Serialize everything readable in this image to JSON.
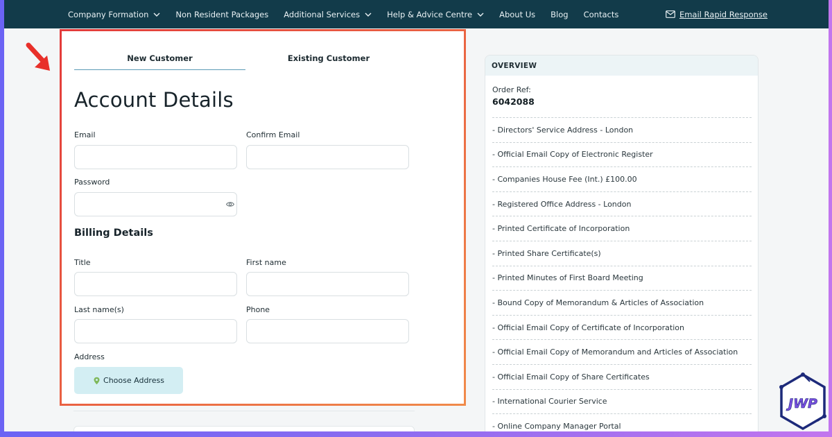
{
  "nav": {
    "items": [
      {
        "label": "Company Formation",
        "dropdown": true
      },
      {
        "label": "Non Resident Packages",
        "dropdown": false
      },
      {
        "label": "Additional Services",
        "dropdown": true
      },
      {
        "label": "Help & Advice Centre",
        "dropdown": true
      },
      {
        "label": "About Us",
        "dropdown": false
      },
      {
        "label": "Blog",
        "dropdown": false
      },
      {
        "label": "Contacts",
        "dropdown": false
      }
    ],
    "rapid_label": "Email Rapid Response"
  },
  "tabs": {
    "new_customer": "New Customer",
    "existing_customer": "Existing Customer"
  },
  "form": {
    "title": "Account Details",
    "email_label": "Email",
    "confirm_email_label": "Confirm Email",
    "password_label": "Password",
    "billing_title": "Billing Details",
    "title_label": "Title",
    "first_name_label": "First name",
    "last_name_label": "Last name(s)",
    "phone_label": "Phone",
    "address_label": "Address",
    "choose_address": "Choose Address"
  },
  "overview": {
    "header": "OVERVIEW",
    "order_ref_label": "Order Ref:",
    "order_ref": "6042088",
    "items": [
      "- Directors' Service Address - London",
      "- Official Email Copy of Electronic Register",
      "- Companies House Fee (Int.) £100.00",
      "- Registered Office Address - London",
      "- Printed Certificate of Incorporation",
      "- Printed Share Certificate(s)",
      "- Printed Minutes of First Board Meeting",
      "- Bound Copy of Memorandum & Articles of Association",
      "- Official Email Copy of Certificate of Incorporation",
      "- Official Email Copy of Memorandum and Articles of Association",
      "- Official Email Copy of Share Certificates",
      "- International Courier Service",
      "- Online Company Manager Portal"
    ]
  },
  "logo": {
    "text": "JWP"
  },
  "colors": {
    "nav_bg": "#123b4a",
    "highlight_border": "#e85a3a",
    "address_button_bg": "#d3eef3",
    "tab_underline": "#5a9bb5"
  }
}
